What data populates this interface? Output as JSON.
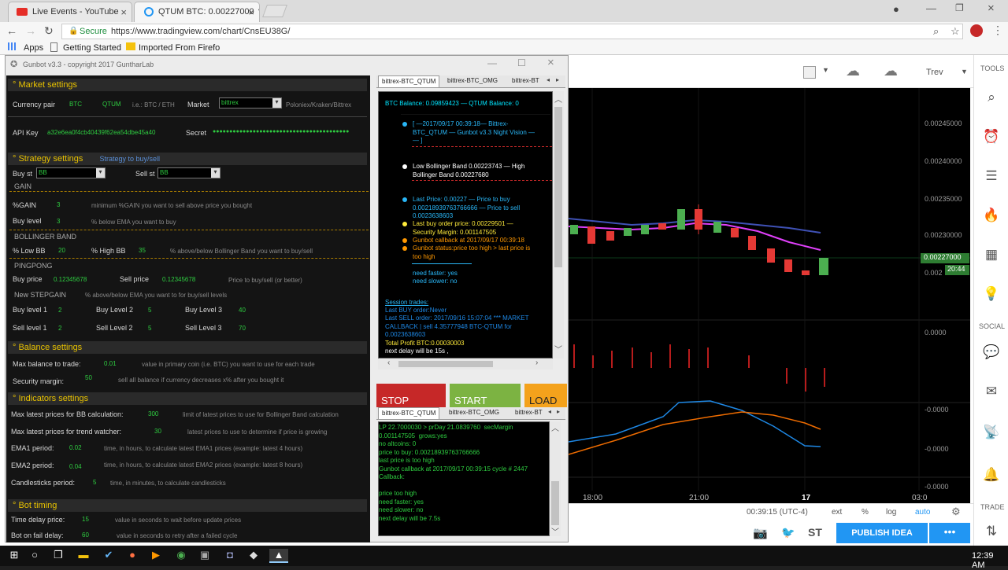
{
  "browser": {
    "tabs": [
      {
        "title": "Live Events - YouTube"
      },
      {
        "title": "QTUM BTC: 0.00227000 ▼"
      }
    ],
    "secure_label": "Secure",
    "url": "https://www.tradingview.com/chart/CnsEU38G/",
    "bookmarks": [
      "Apps",
      "Getting Started",
      "Imported From Firefo"
    ]
  },
  "gunbot": {
    "title": "Gunbot v3.3 - copyright 2017 GuntharLab",
    "market_settings": {
      "heading": "Market settings",
      "currency_pair_label": "Currency pair",
      "base": "BTC",
      "quote": "QTUM",
      "pair_hint": "i.e.: BTC / ETH",
      "market_label": "Market",
      "market_value": "bittrex",
      "market_hint": "Poloniex/Kraken/Bittrex",
      "api_key_label": "API Key",
      "api_key_value": "a32e6ea0f4cb40439f62ea54dbe45a40",
      "secret_label": "Secret",
      "secret_value": "●●●●●●●●●●●●●●●●●●●●●●●●●●●●●●●●●●●●●●●●●"
    },
    "strategy_settings": {
      "heading": "Strategy settings",
      "subheading": "Strategy to buy/sell",
      "buy_label": "Buy st",
      "buy_value": "BB",
      "sell_label": "Sell st",
      "sell_value": "BB",
      "gain_heading": "GAIN",
      "pct_gain_label": "%GAIN",
      "pct_gain_value": "3",
      "pct_gain_hint": "minimum %GAIN you want to sell above price you bought",
      "buy_level_label": "Buy level",
      "buy_level_value": "3",
      "buy_level_hint": "% below EMA you want to buy",
      "bb_heading": "BOLLINGER BAND",
      "low_bb_label": "% Low BB",
      "low_bb_value": "20",
      "high_bb_label": "% High BB",
      "high_bb_value": "35",
      "bb_hint": "% above/below Bollinger Band you want to buy/sell",
      "pingpong_heading": "PINGPONG",
      "buy_price_label": "Buy price",
      "buy_price_value": "0.12345678",
      "sell_price_label": "Sell price",
      "sell_price_value": "0.12345678",
      "pingpong_hint": "Price to buy/sell (or better)",
      "stepgain_heading": "New STEPGAIN",
      "stepgain_hint": "% above/below EMA you want to for buy/sell levels",
      "buy_levels": [
        {
          "label": "Buy level 1",
          "value": "2"
        },
        {
          "label": "Buy Level 2",
          "value": "5"
        },
        {
          "label": "Buy Level 3",
          "value": "40"
        }
      ],
      "sell_levels": [
        {
          "label": "Sell level 1",
          "value": "2"
        },
        {
          "label": "Sell Level 2",
          "value": "5"
        },
        {
          "label": "Sell Level 3",
          "value": "70"
        }
      ]
    },
    "balance_settings": {
      "heading": "Balance settings",
      "max_balance_label": "Max balance to trade:",
      "max_balance_value": "0.01",
      "max_balance_hint": "value in primary coin (i.e. BTC) you want to use for each trade",
      "security_margin_label": "Security margin:",
      "security_margin_value": "50",
      "security_margin_hint": "sell all balance if currency decreases x% after you bought it"
    },
    "indicators_settings": {
      "heading": "Indicators settings",
      "rows": [
        {
          "label": "Max latest prices for BB calculation:",
          "value": "300",
          "hint": "limit of latest prices to use for Bollinger Band calculation"
        },
        {
          "label": "Max latest prices for trend watcher:",
          "value": "30",
          "hint": "latest prices to use to determine if price is growing"
        },
        {
          "label": "EMA1 period:",
          "value": "0.02",
          "hint": "time, in hours, to calculate latest EMA1 prices (example: latest 4 hours)"
        },
        {
          "label": "EMA2 period:",
          "value": "0.04",
          "hint": "time, in hours, to calculate latest EMA2 prices (example: latest 8 hours)"
        },
        {
          "label": "Candlesticks period:",
          "value": "5",
          "hint": "time, in minutes, to calculate candlesticks"
        }
      ]
    },
    "bot_timing": {
      "heading": "Bot timing",
      "rows": [
        {
          "label": "Time delay price:",
          "value": "15",
          "hint": "value in seconds to wait before update prices"
        },
        {
          "label": "Bot on fail delay:",
          "value": "60",
          "hint": "value in seconds to retry after a failed cycle"
        }
      ]
    },
    "top_tabs": [
      "bittrex-BTC_QTUM",
      "bittrex-BTC_OMG",
      "bittrex-BT"
    ],
    "top_log": {
      "balance_line": "BTC Balance: 0.09859423 — QTUM Balance: 0",
      "entries": [
        {
          "bullet": "#29b6f6",
          "text": "[ —2017/09/17 00:39:18— Bittrex-\nBTC_QTUM — Gunbot v3.3 Night Vision —\n— ]",
          "color": "#29b6f6"
        },
        {
          "bullet": "#ffffff",
          "text": "Low Bollinger Band 0.00223743 — High\nBollinger Band 0.00227680",
          "color": "#ffffff"
        },
        {
          "bullet": "#29b6f6",
          "text": "Last Price: 0.00227 — Price to buy\n0.00218939763766666 — Price to sell\n0.0023638603",
          "color": "#29b6f6"
        },
        {
          "bullet": "#ffeb3b",
          "text": "Last buy order price: 0.00229501 —\nSecurity Margin: 0.001147505",
          "color": "#ffeb3b"
        },
        {
          "bullet": "#ff9800",
          "text": "Gunbot callback at 2017/09/17 00:39:18",
          "color": "#ff9800"
        },
        {
          "bullet": "#ff9800",
          "text": "Gunbot status:price too high > last price is\ntoo high",
          "color": "#ff9800"
        }
      ],
      "need_faster": "need faster: yes",
      "need_slower": "need slower: no",
      "session_title": "Session trades:",
      "last_buy": "Last BUY order:Never",
      "last_sell": "Last SELL order: 2017/09/16 15:07:04 *** MARKET\nCALLBACK | sell 4.35777948 BTC-QTUM for\n0.0023638603",
      "total_profit": "Total Profit BTC:0.00030003",
      "next_delay": "next delay will be 15s ,"
    },
    "buttons": {
      "stop": "STOP",
      "start": "START",
      "load": "LOAD"
    },
    "bottom_tabs": [
      "bittrex-BTC_QTUM",
      "bittrex-BTC_OMG",
      "bittrex-BT"
    ],
    "bottom_log": "LP 22.7000030 > prDay 21.0839760  secMargin\n0.001147505  grows:yes\nno altcoins: 0\nprice to buy: 0.00218939763766666\nlast price is too high\nGunbot callback at 2017/09/17 00:39:15 cycle # 2447\nCallback:\n\nprice too high\nneed faster: yes\nneed slower: no\nnext delay will be 7.5s"
  },
  "chart": {
    "symbol_short": "Trev",
    "price_labels": [
      "0.00245000",
      "0.00240000",
      "0.00235000",
      "0.00230000",
      "0.00227000",
      "0.002",
      "0.0000",
      "-0.0000",
      "-0.0000",
      "-0.0000"
    ],
    "last_price": "0.00227000",
    "countdown": "20:44",
    "time_labels": [
      "18:00",
      "21:00",
      "17",
      "03:0"
    ],
    "status_time": "00:39:15 (UTC-4)",
    "status_items": [
      "ext",
      "%",
      "log",
      "auto"
    ],
    "publish": "PUBLISH IDEA",
    "share_st": "ST"
  },
  "right_sidebar": {
    "tools_label": "TOOLS",
    "social_label": "SOCIAL",
    "trade_label": "TRADE"
  },
  "taskbar": {
    "time": "12:39 AM"
  }
}
